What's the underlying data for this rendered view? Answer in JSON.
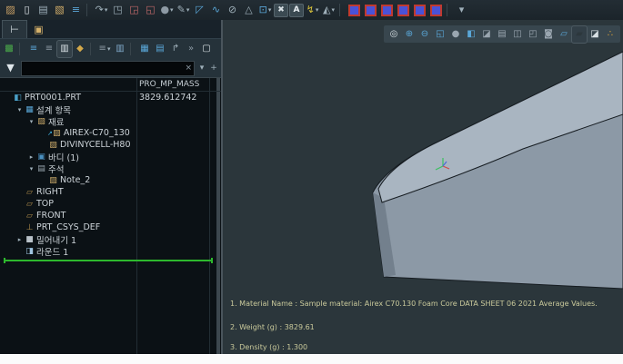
{
  "top_toolbar": {
    "icons": [
      {
        "name": "open-session-icon"
      },
      {
        "name": "new-file-icon"
      },
      {
        "name": "save-icon"
      },
      {
        "name": "open-icon"
      },
      {
        "name": "regenerate-icon"
      },
      {
        "name": "separator"
      },
      {
        "name": "undo-icon",
        "caret": true
      },
      {
        "name": "copy-icon"
      },
      {
        "name": "paste-icon"
      },
      {
        "name": "paste-special-icon"
      },
      {
        "name": "render-sphere-icon",
        "caret": true
      },
      {
        "name": "measure-icon",
        "caret": true
      },
      {
        "name": "corner-icon"
      },
      {
        "name": "spline-icon"
      },
      {
        "name": "no-symbol-icon"
      },
      {
        "name": "datum-triangle-icon"
      },
      {
        "name": "frame-icon",
        "caret": true
      },
      {
        "name": "close-x-icon"
      },
      {
        "name": "annotation-a-icon"
      },
      {
        "name": "analysis-lightning-icon",
        "caret": true
      },
      {
        "name": "datum-display-icon",
        "caret": true
      },
      {
        "name": "separator"
      },
      {
        "name": "saved-orientation-icon"
      },
      {
        "name": "saved-orientation-icon"
      },
      {
        "name": "saved-orientation-icon"
      },
      {
        "name": "saved-orientation-icon"
      },
      {
        "name": "saved-orientation-icon"
      },
      {
        "name": "saved-orientation-icon"
      },
      {
        "name": "separator"
      },
      {
        "name": "toolbar-overflow-icon"
      }
    ]
  },
  "left_panel": {
    "tabs": [
      {
        "name": "model-tree-tab",
        "icon": "tree-icon",
        "selected": true
      },
      {
        "name": "folder-browser-tab",
        "icon": "folders-icon",
        "selected": false
      }
    ],
    "tree_toolbar_icons": [
      {
        "name": "tree-settings-icon"
      },
      {
        "name": "separator"
      },
      {
        "name": "list-blue-icon"
      },
      {
        "name": "list-gray-icon"
      },
      {
        "name": "show-columns-icon",
        "pressed": true
      },
      {
        "name": "bookmark-icon"
      },
      {
        "name": "separator"
      },
      {
        "name": "filter-list-icon",
        "caret": true
      },
      {
        "name": "columns-setup-icon"
      },
      {
        "name": "separator"
      },
      {
        "name": "table-icon"
      },
      {
        "name": "layers-icon"
      },
      {
        "name": "tree-expand-icon"
      },
      {
        "name": "chevron-right-icon"
      },
      {
        "name": "document-icon"
      }
    ],
    "filter": {
      "value": "",
      "placeholder": ""
    }
  },
  "tree": {
    "header_column": "PRO_MP_MASS",
    "items": [
      {
        "label": "PRT0001.PRT",
        "icon": "part-icon",
        "indent": 0,
        "value": "3829.612742"
      },
      {
        "label": "설계 항목",
        "icon": "design-items-icon",
        "indent": 1,
        "expander": "open"
      },
      {
        "label": "재료",
        "icon": "materials-icon",
        "indent": 2,
        "expander": "open"
      },
      {
        "label": "AIREX-C70_130",
        "icon": "material-added-icon",
        "indent": 3,
        "added": true
      },
      {
        "label": "DIVINYCELL-H80",
        "icon": "material-icon",
        "indent": 3
      },
      {
        "label": "바디 (1)",
        "icon": "bodies-icon",
        "indent": 2,
        "expander": "closed"
      },
      {
        "label": "주석",
        "icon": "annotations-icon",
        "indent": 2,
        "expander": "open"
      },
      {
        "label": "Note_2",
        "icon": "note-icon",
        "indent": 3
      },
      {
        "label": "RIGHT",
        "icon": "datum-plane-icon",
        "indent": 1
      },
      {
        "label": "TOP",
        "icon": "datum-plane-icon",
        "indent": 1
      },
      {
        "label": "FRONT",
        "icon": "datum-plane-icon",
        "indent": 1
      },
      {
        "label": "PRT_CSYS_DEF",
        "icon": "csys-icon",
        "indent": 1
      },
      {
        "label": "밀어내기 1",
        "icon": "extrude-icon",
        "indent": 1,
        "expander": "closed"
      },
      {
        "label": "라운드 1",
        "icon": "round-icon",
        "indent": 1
      }
    ]
  },
  "graphics": {
    "gfx_toolbar_icons": [
      {
        "name": "refit-icon"
      },
      {
        "name": "zoom-in-icon"
      },
      {
        "name": "zoom-out-icon"
      },
      {
        "name": "repaint-icon"
      },
      {
        "name": "render-style-icon"
      },
      {
        "name": "display-style-icon"
      },
      {
        "name": "section-icon"
      },
      {
        "name": "view-manager-icon"
      },
      {
        "name": "windows-icon"
      },
      {
        "name": "saved-views-icon"
      },
      {
        "name": "appearances-icon"
      },
      {
        "name": "plane-display-icon"
      },
      {
        "name": "plane-display-off-icon",
        "pressed": true
      },
      {
        "name": "edge-display-icon"
      },
      {
        "name": "datum-points-icon"
      }
    ],
    "notes": [
      "1. Material Name : Sample material: Airex C70.130 Foam Core DATA SHEET 06 2021 Average Values.",
      "2. Weight (g) : 3829.61",
      "3. Density (g) :  1.300"
    ]
  },
  "colors": {
    "insert_line": "#2db82d",
    "graphics_bg": "#2b363b",
    "model_top": "#a9b5c1",
    "model_front": "#8c99a6",
    "model_side": "#73808d",
    "model_edge": "#161c21",
    "annotation_text": "#c9c99b",
    "csys_green": "#3bc060",
    "csys_red": "#d04848",
    "csys_blue": "#4868d8"
  }
}
